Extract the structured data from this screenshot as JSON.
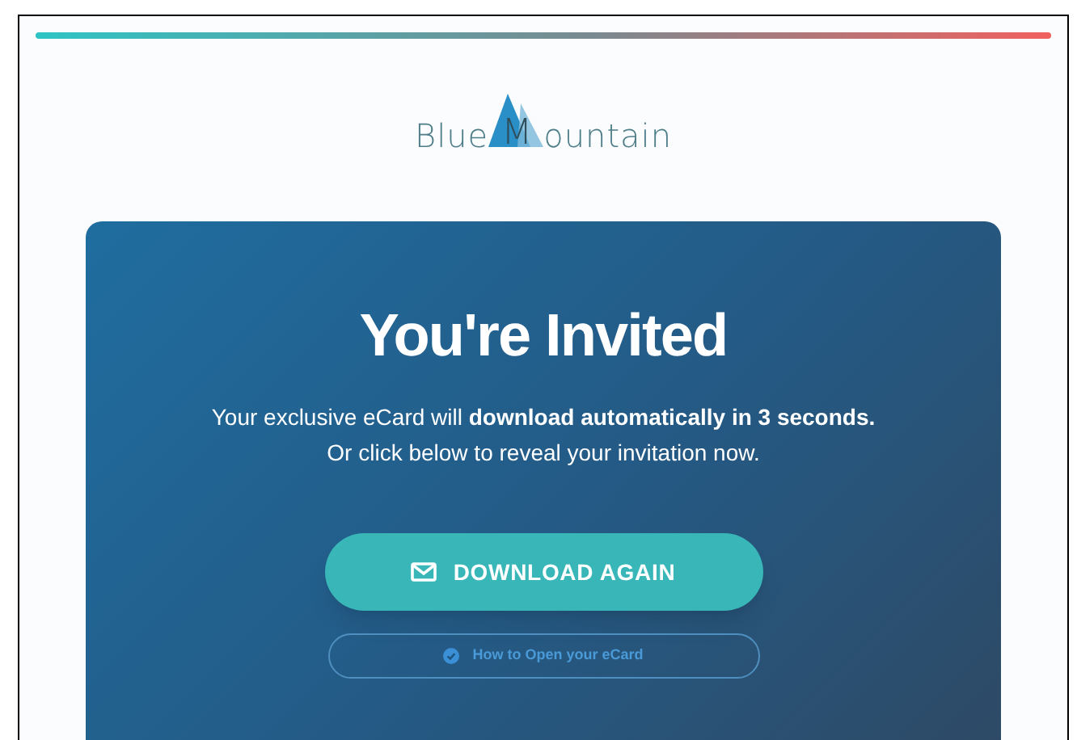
{
  "logo": {
    "before": "Blue",
    "letter": "M",
    "after": "ountain"
  },
  "card": {
    "title": "You're Invited",
    "message": [
      "Your exclusive eCard will **download automatically in 3 seconds.**",
      "Or click below to reveal your invitation now."
    ],
    "primary_button": "DOWNLOAD AGAIN",
    "secondary_button": "How to Open your eCard"
  }
}
